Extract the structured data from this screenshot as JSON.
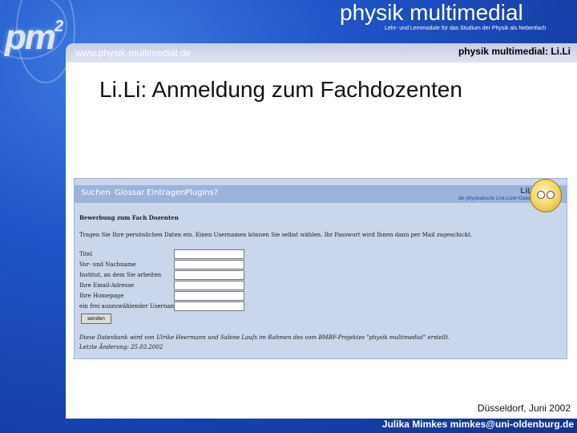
{
  "brand": "physik multimedial",
  "tagline": "Lehr- und Lernmodule für das Studium der Physik als Nebenfach",
  "logo": "pm",
  "logo_sup": "2",
  "url": "www.physik-multimedial.de",
  "section": "physik multimedial: Li.Li",
  "title": "Li.Li: Anmeldung zum Fachdozenten",
  "screenshot": {
    "nav": [
      "Suchen",
      "Glossar",
      "Eintragen",
      "Plugins?"
    ],
    "logo_text": "LiLi",
    "logo_sub": "die physikalische Link-Liste+Datenbank",
    "heading": "Bewerbung zum Fach Dozenten",
    "intro": "Tragen Sie Ihre persönlichen Daten ein. Einen Usernamen können Sie selbst wählen. Ihr Passwort wird Ihnen dann per Mail zugeschickt.",
    "fields": [
      "Titel",
      "Vor- und Nachname",
      "Institut, an dem Sie arbeiten",
      "Ihre Email-Adresse",
      "Ihre Homepage",
      "ein frei auszuwählender Username"
    ],
    "button": "senden",
    "credit": "Diese Datenbank wird von Ulrike Heermann und Sabine Laufs im Rahmen des vom BMBF-Projektes \"physik multimedial\" erstellt.",
    "last_change": "Letzte Änderung: 25.03.2002"
  },
  "footer": {
    "place_date": "Düsseldorf, Juni 2002",
    "author": "Julika Mimkes mimkes@uni-oldenburg.de"
  }
}
